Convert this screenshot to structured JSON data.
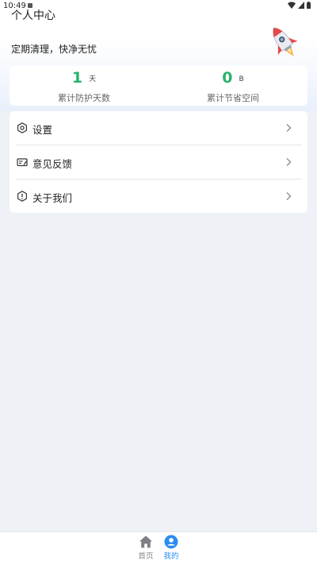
{
  "status_bar": {
    "time": "10:49"
  },
  "header": {
    "title": "个人中心",
    "slogan": "定期清理，快净无忧",
    "rocket_icon": "rocket-icon"
  },
  "stats": [
    {
      "value": "1",
      "unit": "天",
      "label": "累计防护天数"
    },
    {
      "value": "0",
      "unit": "B",
      "label": "累计节省空间"
    }
  ],
  "menu": {
    "items": [
      {
        "label": "设置",
        "icon": "gear-icon"
      },
      {
        "label": "意见反馈",
        "icon": "feedback-icon"
      },
      {
        "label": "关于我们",
        "icon": "info-icon"
      }
    ]
  },
  "bottom_nav": {
    "items": [
      {
        "label": "首页",
        "icon": "home-icon",
        "active": false
      },
      {
        "label": "我的",
        "icon": "user-icon",
        "active": true
      }
    ]
  },
  "colors": {
    "accent_green": "#27b36b",
    "active_blue": "#2a8cf0",
    "page_bg": "#eef1f6"
  }
}
